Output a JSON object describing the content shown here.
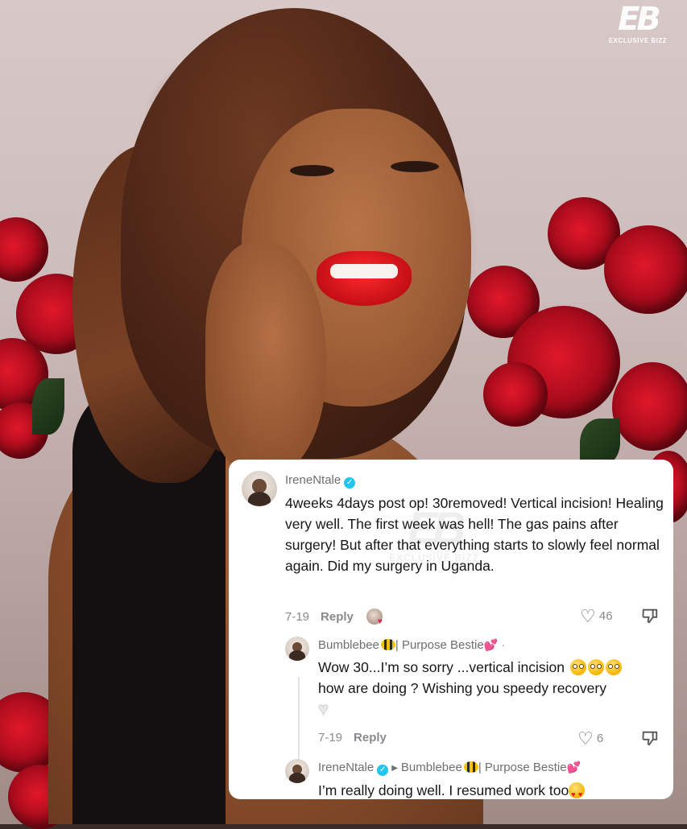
{
  "watermark": {
    "logo_mark": "EB",
    "logo_text": "EXCLUSIVE BIZZ"
  },
  "comment": {
    "username": "IreneNtale",
    "verified": true,
    "text": "4weeks 4days post op! 30removed! Vertical incision! Healing very well. The first week was hell! The gas pains after surgery! But after that everything starts to slowly feel normal again. Did my surgery in Uganda.",
    "date": "7-19",
    "reply_label": "Reply",
    "likes": "46",
    "creator_liked": true
  },
  "reply1": {
    "username": "Bumblebee",
    "username_suffix": "| Purpose Bestie",
    "text_line1": "Wow 30...I’m so sorry ...vertical incision",
    "text_line2": "how are doing ? Wishing you speedy recovery",
    "date": "7-19",
    "reply_label": "Reply",
    "likes": "6"
  },
  "reply2": {
    "username": "IreneNtale",
    "verified": true,
    "reply_to": "Bumblebee",
    "reply_to_suffix": "| Purpose Bestie",
    "text": "I’m really doing well. I resumed work too"
  },
  "colors": {
    "verified_badge": "#20c5f0",
    "text_primary": "#161616",
    "text_secondary": "#8a8a8e",
    "card_background": "#ffffff"
  },
  "icons": [
    "verified-badge-icon",
    "heart-outline-icon",
    "dislike-icon",
    "flushed-face-emoji",
    "bee-emoji",
    "pink-hearts-emoji",
    "white-heart-emoji",
    "heart-eyes-emoji",
    "right-triangle-icon"
  ]
}
